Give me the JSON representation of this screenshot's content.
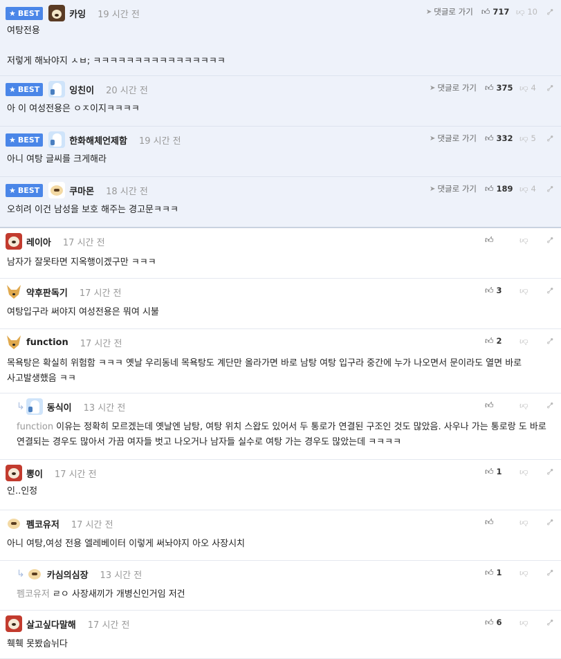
{
  "best_label": "BEST",
  "reply_label": "댓글로 가기",
  "comments": [
    {
      "best": true,
      "avatar": "bear",
      "nick": "카잉",
      "time": "19 시간 전",
      "text": "여탕전용\n\n저렇게 해놔야지 ㅅㅂ; ㅋㅋㅋㅋㅋㅋㅋㅋㅋㅋㅋㅋㅋㅋㅋㅋ",
      "up": "717",
      "down": "10"
    },
    {
      "best": true,
      "avatar": "blue",
      "nick": "잉친이",
      "time": "20 시간 전",
      "text": "아 이 여성전용은 ㅇㅈ이지ㅋㅋㅋㅋ",
      "up": "375",
      "down": "4"
    },
    {
      "best": true,
      "avatar": "blue",
      "nick": "한화해체언제함",
      "time": "19 시간 전",
      "text": "아니 여탕 글씨를 크게해라",
      "up": "332",
      "down": "5"
    },
    {
      "best": true,
      "avatar": "puppy",
      "nick": "쿠마몬",
      "time": "18 시간 전",
      "text": "오히려 이건 남성을 보호 해주는 경고문ㅋㅋㅋ",
      "up": "189",
      "down": "4"
    },
    {
      "avatar": "red",
      "nick": "레이아",
      "time": "17 시간 전",
      "text": "남자가 잘못타면 지옥행이겠구만 ㅋㅋㅋ",
      "up": "",
      "down": ""
    },
    {
      "avatar": "fox",
      "nick": "약후판독기",
      "time": "17 시간 전",
      "text": "여탕입구라 써야지 여성전용은 뭐여 시불",
      "up": "3",
      "down": ""
    },
    {
      "avatar": "fox",
      "nick": "function",
      "time": "17 시간 전",
      "text": "목욕탕은 확실히 위험함 ㅋㅋㅋ 옛날 우리동네 목욕탕도 계단만 올라가면 바로 남탕 여탕 입구라 중간에 누가 나오면서 문이라도 열면 바로 사고발생했음 ㅋㅋ",
      "up": "2",
      "down": ""
    },
    {
      "reply": true,
      "avatar": "blue",
      "nick": "동식이",
      "time": "13 시간 전",
      "mention": "function",
      "text": "이유는 정확히 모르겠는데 옛날엔 남탕, 여탕 위치 스왑도 있어서 두 통로가 연결된 구조인 것도 많았음. 사우나 가는 통로랑 도 바로 연결되는 경우도 많아서 가끔 여자들 벗고 나오거나 남자들 실수로 여탕 가는 경우도 많았는데 ㅋㅋㅋㅋ",
      "up": "",
      "down": ""
    },
    {
      "avatar": "red",
      "nick": "뽕이",
      "time": "17 시간 전",
      "text": "인..인정",
      "up": "1",
      "down": ""
    },
    {
      "avatar": "puppy",
      "nick": "펨코유저",
      "time": "17 시간 전",
      "text": "아니 여탕,여성 전용 엘레베이터 이렇게 써놔야지 아오 사장시치",
      "up": "",
      "down": ""
    },
    {
      "reply": true,
      "avatar": "puppy",
      "nick": "카심의심장",
      "time": "13 시간 전",
      "mention": "펨코유저",
      "text": "ㄹㅇ 사장새끼가 개병신인거임 저건",
      "up": "1",
      "down": ""
    },
    {
      "avatar": "red",
      "nick": "살고싶다말해",
      "time": "17 시간 전",
      "text": "훽훽 못봤숩뉘다",
      "up": "6",
      "down": ""
    }
  ]
}
